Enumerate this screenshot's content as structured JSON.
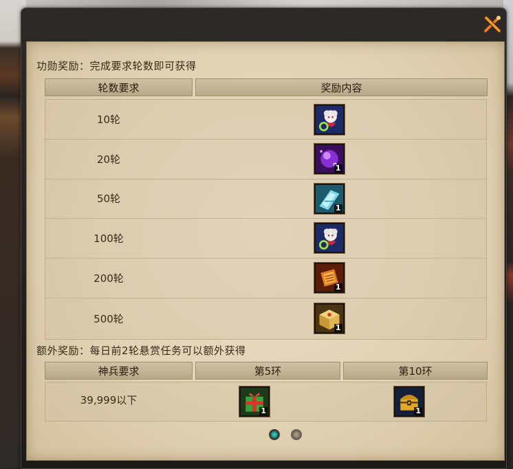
{
  "merit": {
    "title": "功勋奖励：完成要求轮数即可获得",
    "headers": [
      "轮数要求",
      "奖励内容"
    ],
    "rows": [
      {
        "label": "10轮",
        "icon": "doll-charm-icon",
        "qty": ""
      },
      {
        "label": "20轮",
        "icon": "purple-orb-icon",
        "qty": "1"
      },
      {
        "label": "50轮",
        "icon": "blue-crystal-icon",
        "qty": "1"
      },
      {
        "label": "100轮",
        "icon": "doll-charm-icon",
        "qty": ""
      },
      {
        "label": "200轮",
        "icon": "orange-scroll-icon",
        "qty": "1"
      },
      {
        "label": "500轮",
        "icon": "gold-chest-icon",
        "qty": "1"
      }
    ]
  },
  "bonus": {
    "title": "额外奖励：每日前2轮悬赏任务可以额外获得",
    "headers": [
      "神兵要求",
      "第5环",
      "第10环"
    ],
    "row": {
      "label": "39,999以下",
      "rewards": [
        {
          "icon": "green-gift-box-icon",
          "qty": "1"
        },
        {
          "icon": "treasure-chest-icon",
          "qty": "1"
        }
      ]
    }
  },
  "pager": {
    "pages": 2,
    "current": 1
  },
  "colors": {
    "parchment": "#e6d8bd",
    "text": "#3a2a18",
    "active_dot": "#3cc2b0"
  }
}
